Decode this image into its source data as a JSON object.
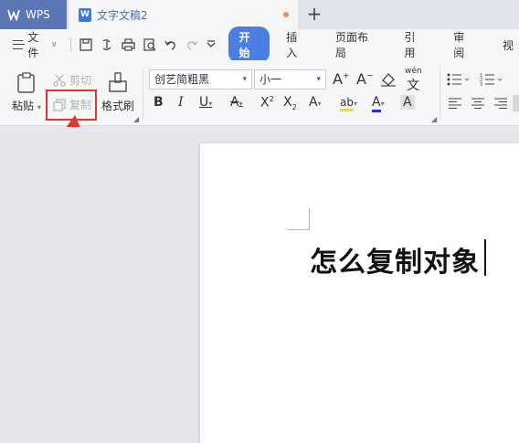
{
  "titlebar": {
    "app_tab": "WPS",
    "doc_tab": "文字文稿2",
    "new_tab_icon": "plus-icon"
  },
  "menubar": {
    "file_label": "文件",
    "tabs": [
      "开始",
      "插入",
      "页面布局",
      "引用",
      "审阅",
      "视"
    ],
    "active_tab": "开始"
  },
  "ribbon": {
    "paste_label": "粘贴",
    "cut_label": "剪切",
    "copy_label": "复制",
    "format_painter_label": "格式刷",
    "font_name": "创艺简粗黑",
    "font_size": "小一",
    "phonetic_label": "wén"
  },
  "document": {
    "body_text": "怎么复制对象"
  },
  "annotation": {
    "highlight_color": "#e3342f"
  }
}
